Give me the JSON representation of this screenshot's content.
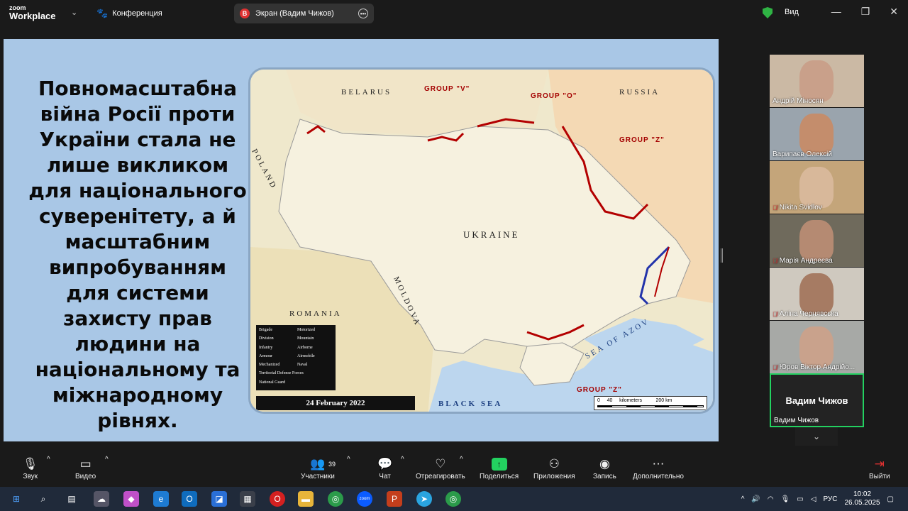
{
  "app": {
    "logo_top": "zoom",
    "logo_bottom": "Workplace",
    "meeting_name": "Конференция"
  },
  "share": {
    "badge": "В",
    "label": "Экран (Вадим Чижов)"
  },
  "view_label": "Вид",
  "slide": {
    "text": "Повномасштабна війна Росії проти України стала не лише викликом для національного суверенітету, а й масштабним випробуванням для системи захисту прав людини на національному та міжнародному рівнях."
  },
  "map": {
    "countries": {
      "belarus": "BELARUS",
      "russia": "RUSSIA",
      "poland": "POLAND",
      "romania": "ROMANIA",
      "moldova": "MOLDOVA",
      "ukraine": "UKRAINE",
      "black_sea": "BLACK SEA",
      "sea_azov": "SEA OF AZOV"
    },
    "groups": {
      "v": "GROUP \"V\"",
      "o": "GROUP \"O\"",
      "z": "GROUP \"Z\"",
      "z_south": "GROUP \"Z\""
    },
    "date": "24 February 2022",
    "scale": {
      "labels": "0     40     kilometers          200 km"
    },
    "legend": [
      "Brigade",
      "Motorized",
      "Division",
      "Mountain",
      "Infantry",
      "Airborne",
      "Armour",
      "Airmobile",
      "Mechanized",
      "Naval",
      "Territorial Defense Forces",
      "",
      "National Guard",
      ""
    ]
  },
  "participants": [
    {
      "name": "Андрій Міносян",
      "muted": false,
      "bg": "#cbb9a4",
      "face": "#c9a08a"
    },
    {
      "name": "Варипаєв Олексій",
      "muted": false,
      "bg": "#9aa4ad",
      "face": "#c48d6c"
    },
    {
      "name": "Nikita Svidlov",
      "muted": true,
      "bg": "#c4a57a",
      "face": "#d8b89a"
    },
    {
      "name": "Марія Андреєва",
      "muted": true,
      "bg": "#6f6a5c",
      "face": "#b58a72"
    },
    {
      "name": "Аліна Чернявська",
      "muted": true,
      "bg": "#cfc9bf",
      "face": "#a67b63"
    },
    {
      "name": "Юров Віктор Андрійо...",
      "muted": true,
      "bg": "#a7a9a6",
      "face": "#c9a28c"
    }
  ],
  "active_speaker": {
    "big": "Вадим Чижов",
    "name": "Вадим Чижов"
  },
  "toolbar": {
    "audio": "Звук",
    "video": "Видео",
    "participants": "Участники",
    "participants_count": "39",
    "chat": "Чат",
    "react": "Отреагировать",
    "share": "Поделиться",
    "apps": "Приложения",
    "record": "Запись",
    "more": "Дополнительно",
    "leave": "Выйти"
  },
  "taskbar": {
    "lang": "РУС",
    "time": "10:02",
    "date": "26.05.2025"
  }
}
